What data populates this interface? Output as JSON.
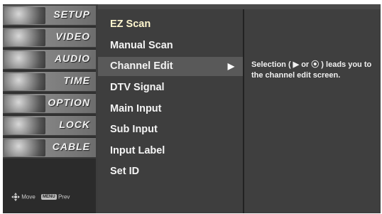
{
  "categories": [
    {
      "label": "SETUP",
      "icon": "setup-icon"
    },
    {
      "label": "VIDEO",
      "icon": "video-icon"
    },
    {
      "label": "AUDIO",
      "icon": "audio-icon"
    },
    {
      "label": "TIME",
      "icon": "time-icon"
    },
    {
      "label": "OPTION",
      "icon": "option-icon"
    },
    {
      "label": "LOCK",
      "icon": "lock-icon"
    },
    {
      "label": "CABLE",
      "icon": "cable-icon"
    }
  ],
  "legend": {
    "move_label": "Move",
    "menu_key": "MENU",
    "prev_label": "Prev"
  },
  "submenu": {
    "items": [
      {
        "label": "EZ Scan"
      },
      {
        "label": "Manual Scan"
      },
      {
        "label": "Channel Edit",
        "arrow": "▶"
      },
      {
        "label": "DTV Signal"
      },
      {
        "label": "Main Input"
      },
      {
        "label": "Sub Input"
      },
      {
        "label": "Input Label"
      },
      {
        "label": "Set ID"
      }
    ]
  },
  "help": {
    "text": "Selection ( ▶ or ⦿ ) leads you to the channel edit screen."
  },
  "colors": {
    "menu_background": "#3e3e3e",
    "highlight": "#595959",
    "text": "#f4f4f4"
  }
}
